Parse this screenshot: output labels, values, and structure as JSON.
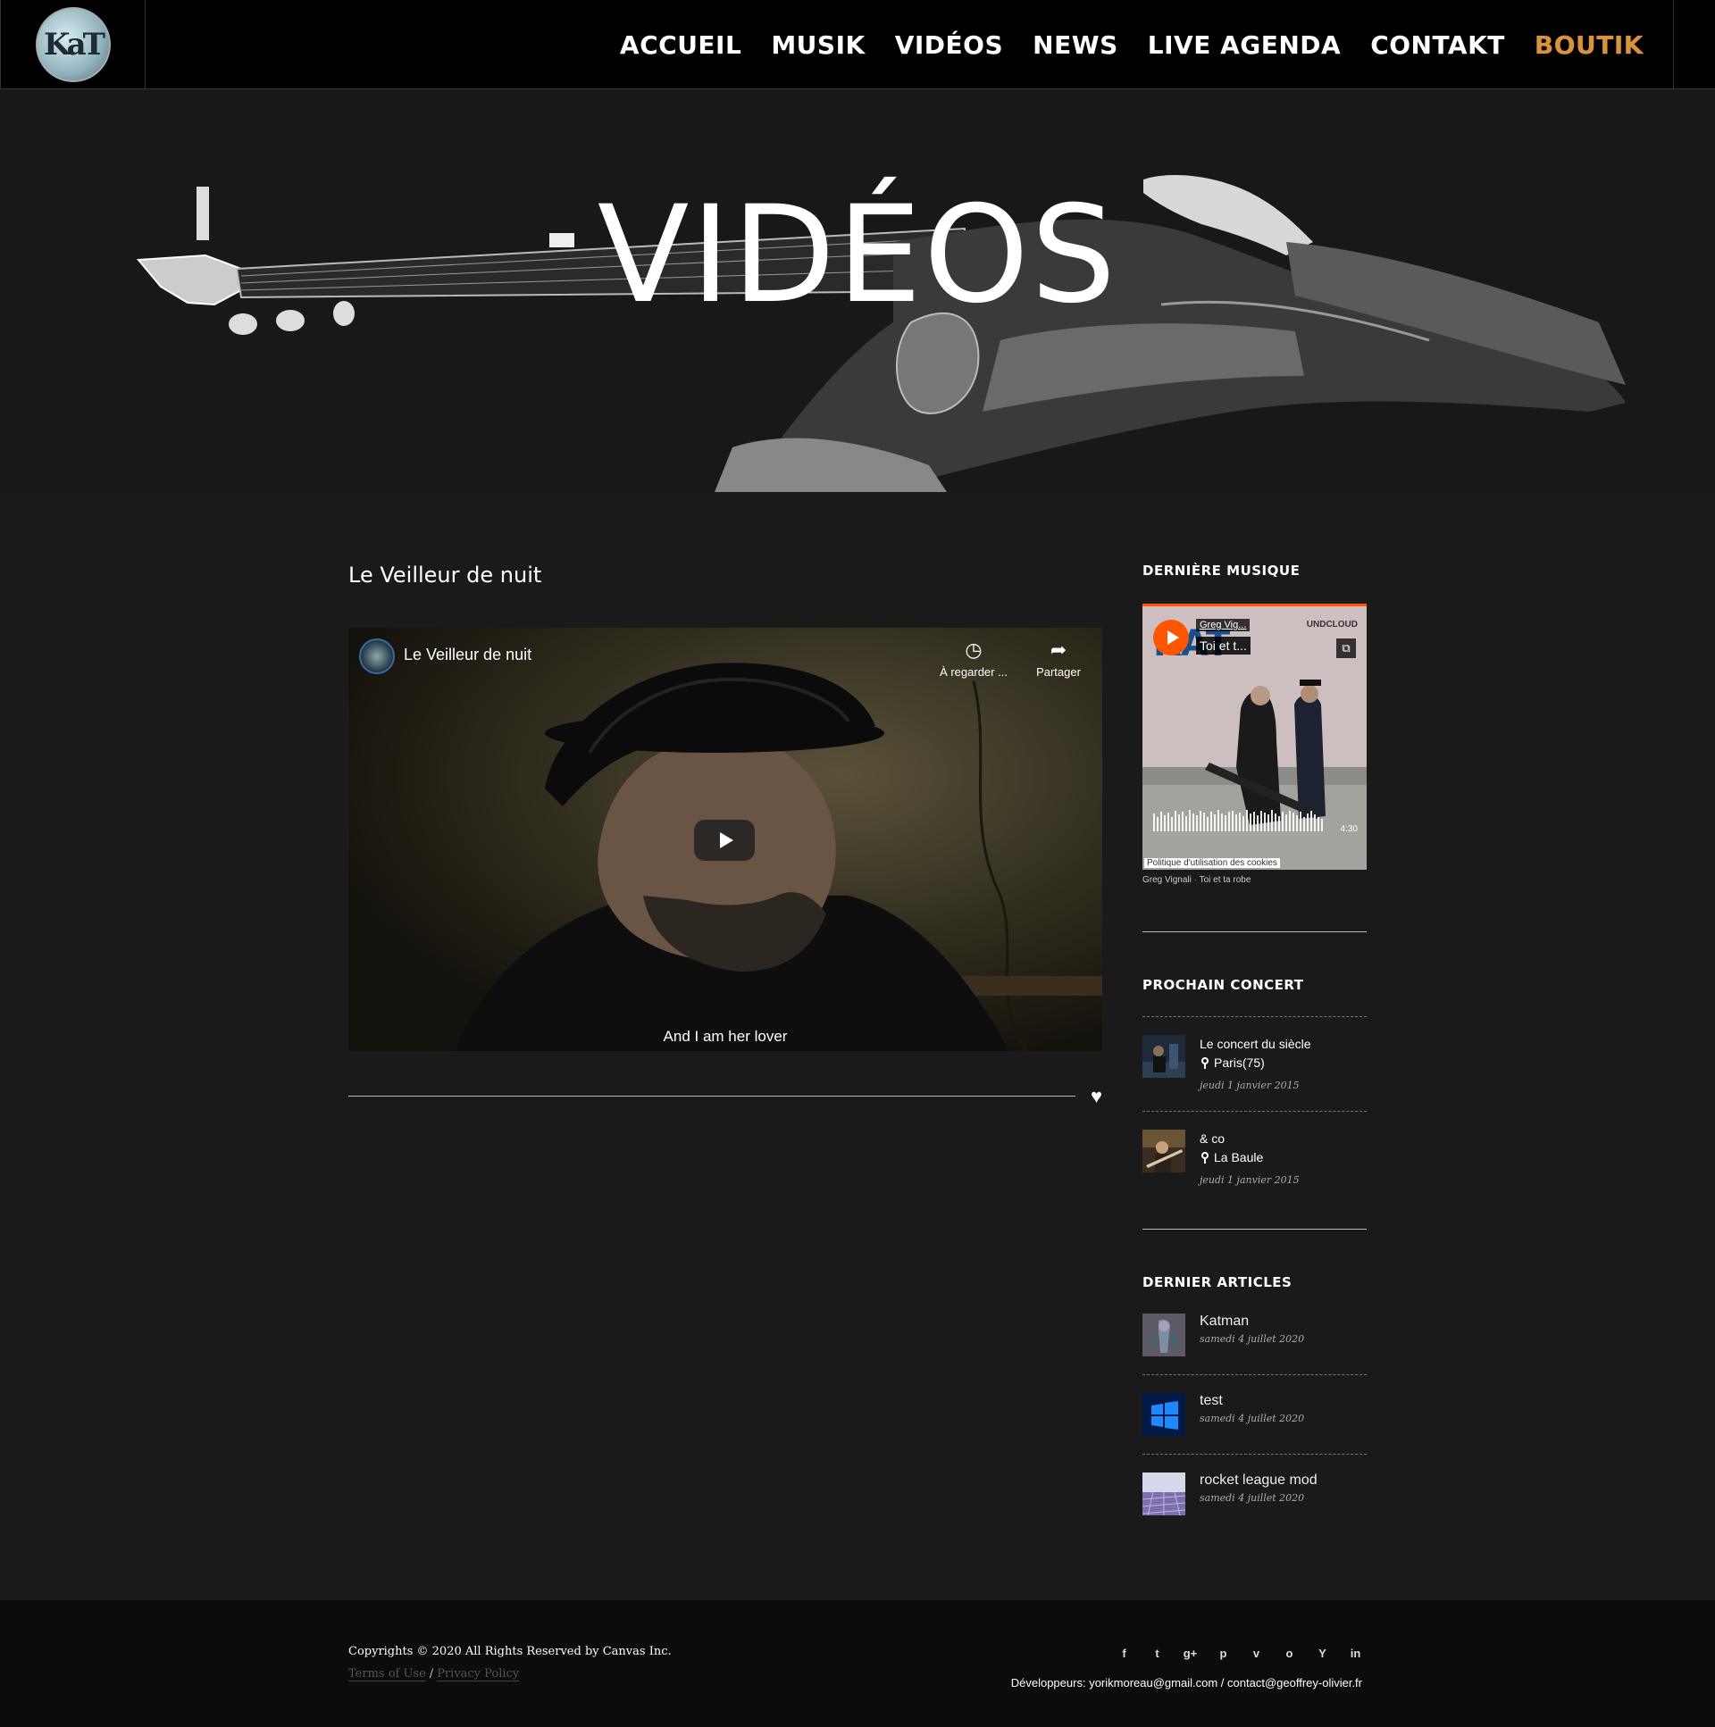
{
  "header": {
    "logo_text": "KaT",
    "nav": [
      {
        "label": "ACCUEIL"
      },
      {
        "label": "MUSIK"
      },
      {
        "label": "VIDÉOS"
      },
      {
        "label": "NEWS"
      },
      {
        "label": "LIVE AGENDA"
      },
      {
        "label": "CONTAKT"
      },
      {
        "label": "BOUTIK"
      }
    ],
    "accent_color": "#d9923f"
  },
  "hero": {
    "title": "VIDÉOS"
  },
  "post": {
    "title": "Le Veilleur de nuit",
    "video": {
      "title": "Le Veilleur de nuit",
      "watch_later": "À regarder ...",
      "share": "Partager",
      "subtitle": "And I am her lover",
      "play_icon": "play-icon"
    },
    "like_icon": "heart-icon"
  },
  "sidebar": {
    "music": {
      "title": "DERNIÈRE MUSIQUE",
      "player": {
        "artist": "Greg Vig...",
        "track": "Toi et t...",
        "brand": "UNDCLOUD",
        "duration": "4:30",
        "cookie": "Politique d'utilisation des cookies",
        "accent": "#ff5500"
      },
      "credit_artist": "Greg Vignali",
      "credit_sep": "·",
      "credit_track": "Toi et ta robe"
    },
    "concerts": {
      "title": "PROCHAIN CONCERT",
      "items": [
        {
          "name": "Le concert du siècle",
          "place": "Paris(75)",
          "date": "jeudi 1 janvier 2015"
        },
        {
          "name": "& co",
          "place": "La Baule",
          "date": "jeudi 1 janvier 2015"
        }
      ]
    },
    "articles": {
      "title": "DERNIER ARTICLES",
      "items": [
        {
          "name": "Katman",
          "date": "samedi 4 juillet 2020"
        },
        {
          "name": "test",
          "date": "samedi 4 juillet 2020"
        },
        {
          "name": "rocket league mod",
          "date": "samedi 4 juillet 2020"
        }
      ]
    }
  },
  "footer": {
    "copyright": "Copyrights © 2020 All Rights Reserved by Canvas Inc.",
    "terms": "Terms of Use",
    "slash": "/",
    "privacy": "Privacy Policy",
    "socials": [
      {
        "icon": "facebook-icon",
        "glyph": "f"
      },
      {
        "icon": "twitter-icon",
        "glyph": "t"
      },
      {
        "icon": "google-plus-icon",
        "glyph": "g+"
      },
      {
        "icon": "pinterest-icon",
        "glyph": "p"
      },
      {
        "icon": "vimeo-icon",
        "glyph": "v"
      },
      {
        "icon": "github-icon",
        "glyph": "o"
      },
      {
        "icon": "yahoo-icon",
        "glyph": "Y"
      },
      {
        "icon": "linkedin-icon",
        "glyph": "in"
      }
    ],
    "devs_label": "Développeurs:",
    "dev1": "yorikmoreau@gmail.com",
    "dev2": "contact@geoffrey-olivier.fr"
  }
}
